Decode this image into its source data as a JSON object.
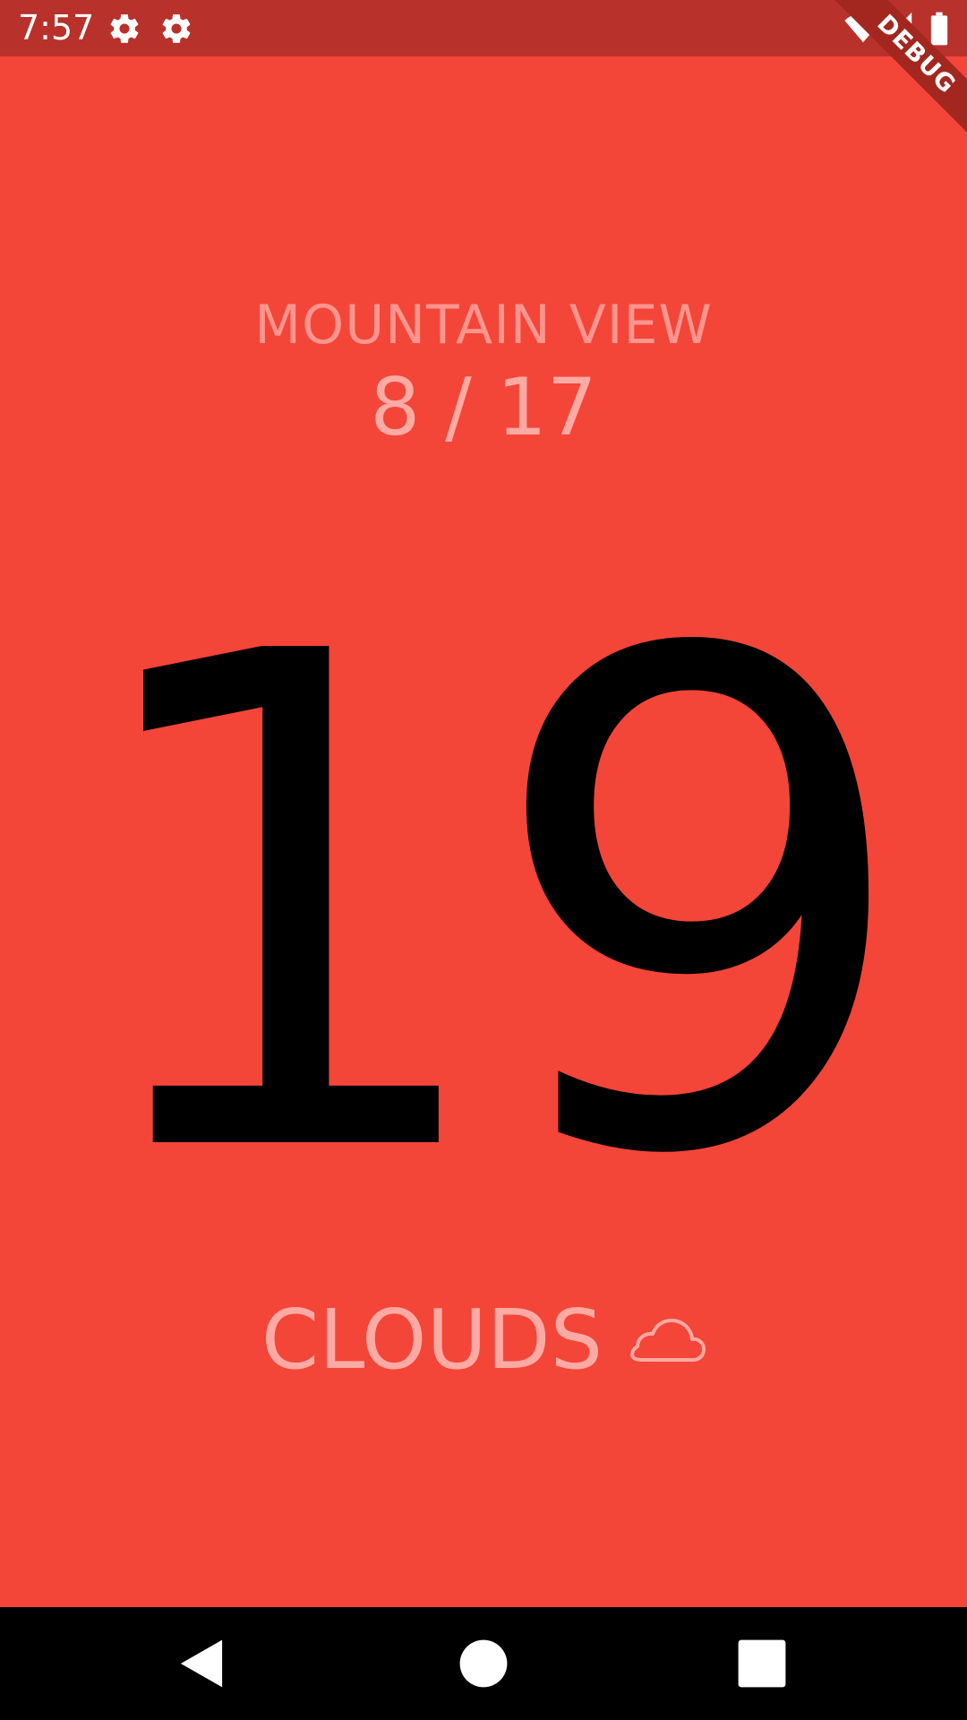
{
  "status_bar": {
    "time": "7:57",
    "left_icons": [
      "gear-icon",
      "gear-icon"
    ],
    "right_icons": [
      "wifi-icon",
      "cell-signal-icon",
      "battery-icon"
    ],
    "background": "#b9312b"
  },
  "debug_banner": {
    "label": "DEBUG"
  },
  "weather": {
    "city": "MOUNTAIN VIEW",
    "date": "8 / 17",
    "temperature": "19",
    "condition": "CLOUDS",
    "condition_icon": "cloud-icon",
    "background": "#f44539"
  },
  "nav_bar": {
    "buttons": [
      "back-icon",
      "home-icon",
      "recents-icon"
    ]
  }
}
